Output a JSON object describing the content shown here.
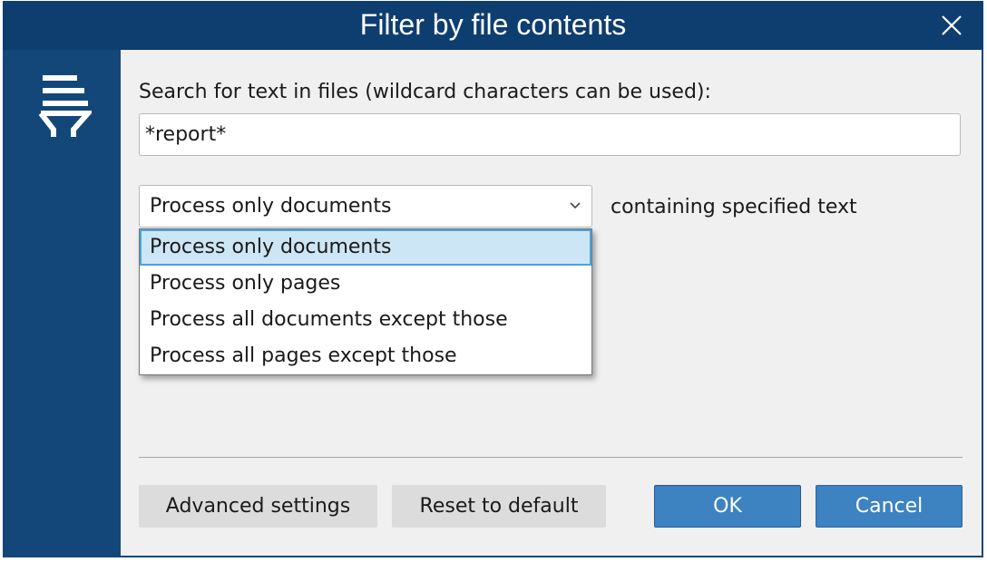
{
  "dialog": {
    "title": "Filter by file contents",
    "close_icon": "close-icon"
  },
  "sidebar": {
    "icon": "filter-icon"
  },
  "search": {
    "label": "Search for text in files (wildcard characters can be used):",
    "value": "*report*"
  },
  "scope": {
    "selected": "Process only documents",
    "suffix": "containing specified text",
    "options": [
      "Process only documents",
      "Process only pages",
      "Process all documents except those",
      "Process all pages except those"
    ]
  },
  "buttons": {
    "advanced": "Advanced settings",
    "reset": "Reset to default",
    "ok": "OK",
    "cancel": "Cancel"
  },
  "colors": {
    "titlebar": "#0e3d70",
    "sidebar": "#13477a",
    "accent": "#3d82c1",
    "selection": "#cce6f6"
  }
}
